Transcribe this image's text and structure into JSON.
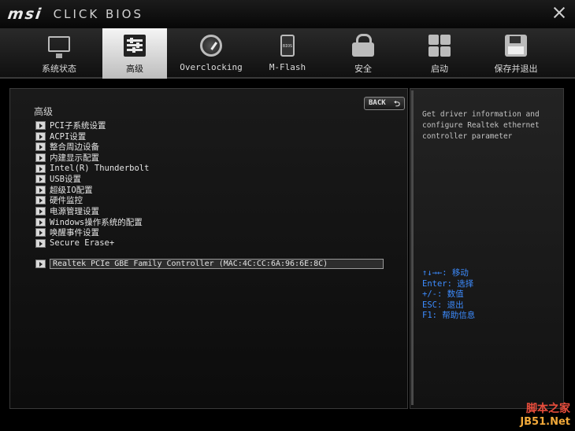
{
  "titlebar": {
    "brand": "msi",
    "product": "CLICK BIOS"
  },
  "nav": {
    "tabs": [
      {
        "label": "系统状态",
        "icon": "monitor-icon",
        "active": false
      },
      {
        "label": "高级",
        "icon": "sliders-icon",
        "active": true
      },
      {
        "label": "Overclocking",
        "icon": "gauge-icon",
        "active": false
      },
      {
        "label": "M-Flash",
        "icon": "usb-bios-icon",
        "active": false
      },
      {
        "label": "安全",
        "icon": "lock-icon",
        "active": false
      },
      {
        "label": "启动",
        "icon": "boot-grid-icon",
        "active": false
      },
      {
        "label": "保存并退出",
        "icon": "floppy-disk-icon",
        "active": false
      }
    ]
  },
  "main": {
    "title": "高级",
    "back_label": "BACK",
    "items": [
      "PCI子系统设置",
      "ACPI设置",
      "整合周边设备",
      "内建显示配置",
      "Intel(R) Thunderbolt",
      "USB设置",
      "超级IO配置",
      "硬件监控",
      "电源管理设置",
      "Windows操作系统的配置",
      "唤醒事件设置",
      "Secure Erase+"
    ],
    "selected_item": "Realtek PCIe GBE Family Controller (MAC:4C:CC:6A:96:6E:8C)"
  },
  "help": {
    "description": "Get driver information and configure Realtek ethernet controller parameter",
    "keys": [
      "↑↓→←: 移动",
      "Enter: 选择",
      "+/-: 数值",
      "ESC: 退出",
      "F1: 帮助信息"
    ]
  },
  "watermark": {
    "line1": "脚本之家",
    "line2": "JB51.Net"
  },
  "colors": {
    "key_help": "#3d8cff",
    "active_tab": "#e6e6e6"
  }
}
